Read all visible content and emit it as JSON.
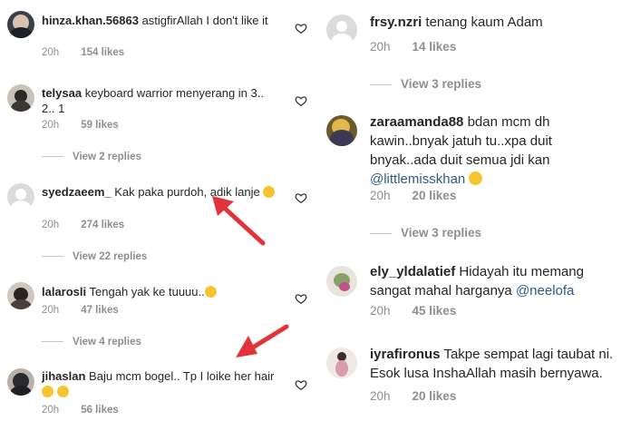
{
  "left_comments": [
    {
      "username": "hinza.khan.56863",
      "text": "astigfirAllah I don't like it",
      "time": "20h",
      "likes": "154 likes"
    },
    {
      "username": "telysaa",
      "text": "keyboard warrior menyerang in 3.. 2.. 1",
      "time": "20h",
      "likes": "59 likes",
      "replies": "View 2 replies"
    },
    {
      "username": "syedzaeem_",
      "text": "Kak paka purdoh, adik lanje",
      "emoji": "joy-emoji",
      "time": "20h",
      "likes": "274 likes",
      "replies": "View 22 replies"
    },
    {
      "username": "lalarosli",
      "text": "Tengah yak ke tuuuu..",
      "emoji": "rolling-eyes-emoji",
      "time": "20h",
      "likes": "47 likes",
      "replies": "View 4 replies"
    },
    {
      "username": "jihaslan",
      "text": "Baju mcm bogel.. Tp I loike her hair",
      "emoji": "heart-eyes-emoji",
      "time": "20h",
      "likes": "56 likes"
    }
  ],
  "right_comments": [
    {
      "username": "frsy.nzri",
      "text": "tenang kaum Adam",
      "time": "20h",
      "likes": "14 likes",
      "replies": "View 3 replies"
    },
    {
      "username": "zaraamanda88",
      "text": "bdan mcm dh kawin..bnyak jatuh tu..xpa duit bnyak..ada duit semua jdi kan",
      "mention": "@littlemisskhan",
      "emoji": "joy-emoji",
      "time": "20h",
      "likes": "20 likes",
      "replies": "View 3 replies"
    },
    {
      "username": "ely_yldalatief",
      "text": "Hidayah itu memang sangat mahal harganya",
      "mention": "@neelofa",
      "time": "20h",
      "likes": "45 likes"
    },
    {
      "username": "iyrafironus",
      "text": "Takpe sempat lagi taubat ni. Esok lusa InshaAllah masih bernyawa.",
      "time": "20h",
      "likes": "20 likes"
    }
  ],
  "colors": {
    "text": "#262626",
    "meta": "#8e8e8e",
    "mention": "#2f5a8a",
    "arrow": "#e2333a",
    "emoji": "#f7c431"
  },
  "icons": [
    "heart-outline-icon",
    "red-arrow-annotation"
  ]
}
